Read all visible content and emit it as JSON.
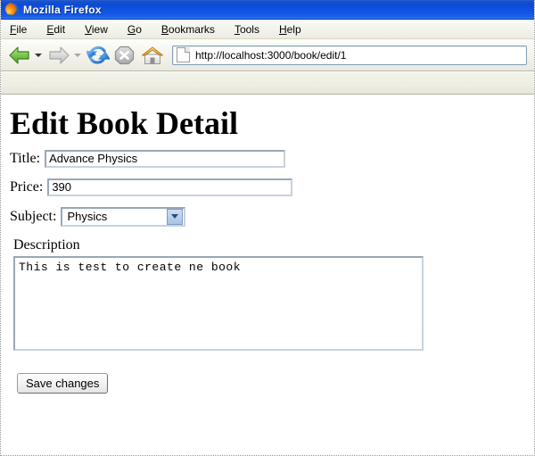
{
  "window": {
    "title": "Mozilla Firefox",
    "app_icon": "firefox-icon"
  },
  "menubar": {
    "items": [
      {
        "label": "File",
        "accesskey": "F"
      },
      {
        "label": "Edit",
        "accesskey": "E"
      },
      {
        "label": "View",
        "accesskey": "V"
      },
      {
        "label": "Go",
        "accesskey": "G"
      },
      {
        "label": "Bookmarks",
        "accesskey": "B"
      },
      {
        "label": "Tools",
        "accesskey": "T"
      },
      {
        "label": "Help",
        "accesskey": "H"
      }
    ]
  },
  "toolbar": {
    "back": {
      "icon": "back-arrow-icon",
      "enabled": true,
      "color": "#6cc04a"
    },
    "forward": {
      "icon": "forward-arrow-icon",
      "enabled": false,
      "color": "#c9c9c9"
    },
    "reload": {
      "icon": "reload-icon",
      "enabled": true,
      "color": "#2f7fd0"
    },
    "stop": {
      "icon": "stop-icon",
      "enabled": false,
      "color": "#b4b4b4"
    },
    "home": {
      "icon": "home-icon",
      "enabled": true,
      "color": "#e8a33d"
    }
  },
  "urlbar": {
    "favicon": "page-icon",
    "value": "http://localhost:3000/book/edit/1"
  },
  "page": {
    "heading": "Edit Book Detail",
    "fields": {
      "title": {
        "label": "Title:",
        "value": "Advance Physics",
        "placeholder": ""
      },
      "price": {
        "label": "Price:",
        "value": "390",
        "placeholder": ""
      },
      "subject": {
        "label": "Subject:",
        "value": "Physics",
        "options": [
          "Physics"
        ]
      },
      "description": {
        "label": "Description",
        "value": "This is test to create ne book",
        "placeholder": ""
      }
    },
    "submit_label": "Save changes"
  },
  "colors": {
    "titlebar": "#0f52e0",
    "chrome": "#eeeee4",
    "field_border": "#9aa7b5",
    "page_bg": "#ffffff"
  }
}
